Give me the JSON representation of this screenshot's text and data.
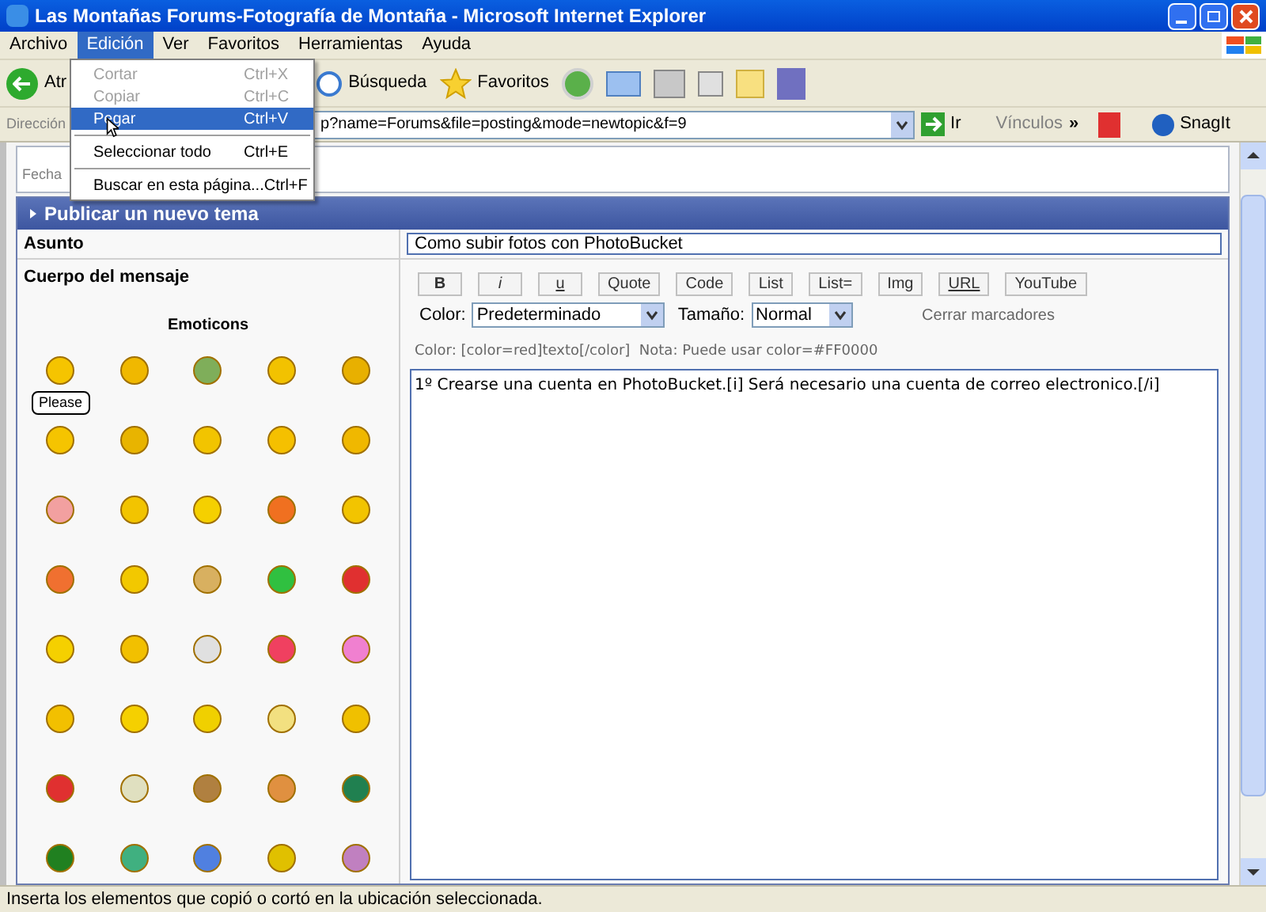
{
  "window": {
    "title": "Las Montañas Forums-Fotografía de Montaña - Microsoft Internet Explorer"
  },
  "menu_bar": [
    {
      "label": "Archivo",
      "selected": false
    },
    {
      "label": "Edición",
      "selected": true
    },
    {
      "label": "Ver",
      "selected": false
    },
    {
      "label": "Favoritos",
      "selected": false
    },
    {
      "label": "Herramientas",
      "selected": false
    },
    {
      "label": "Ayuda",
      "selected": false
    }
  ],
  "edit_menu": [
    {
      "kind": "item",
      "label": "Cortar",
      "shortcut": "Ctrl+X",
      "disabled": true,
      "selected": false
    },
    {
      "kind": "item",
      "label": "Copiar",
      "shortcut": "Ctrl+C",
      "disabled": true,
      "selected": false
    },
    {
      "kind": "item",
      "label": "Pegar",
      "shortcut": "Ctrl+V",
      "disabled": false,
      "selected": true
    },
    {
      "kind": "separator"
    },
    {
      "kind": "item",
      "label": "Seleccionar todo",
      "shortcut": "Ctrl+E",
      "disabled": false,
      "selected": false
    },
    {
      "kind": "separator"
    },
    {
      "kind": "item",
      "label": "Buscar en esta página...",
      "shortcut": "Ctrl+F",
      "disabled": false,
      "selected": false
    }
  ],
  "toolbar": {
    "back_label": "Atr",
    "search_label": "Búsqueda",
    "favorites_label": "Favoritos"
  },
  "address_bar": {
    "label": "Dirección",
    "url": "p?name=Forums&file=posting&mode=newtopic&f=9",
    "go_label": "Ir",
    "links_label": "Vínculos",
    "chevron": "»",
    "snagit_label": "SnagIt"
  },
  "page": {
    "date_label": "Fecha",
    "form_title": "Publicar un nuevo tema",
    "subject_label": "Asunto",
    "subject_value": "Como subir fotos con PhotoBucket",
    "body_label": "Cuerpo del mensaje",
    "emoticons_title": "Emoticons",
    "emoticon_bubble": "Please",
    "bbcode_buttons": [
      "B",
      "i",
      "u",
      "Quote",
      "Code",
      "List",
      "List=",
      "Img",
      "URL",
      "YouTube"
    ],
    "color_label": "Color:",
    "color_value": "Predeterminado",
    "size_label": "Tamaño:",
    "size_value": "Normal",
    "close_tags": "Cerrar marcadores",
    "help_line": "Color: [color=red]texto[/color]  Nota: Puede usar color=#FF0000",
    "message": "1º Crearse una cuenta en PhotoBucket.[i] Será necesario una cuenta de correo electronico.[/i]"
  },
  "status_bar": {
    "text": "Inserta los elementos que copió o cortó en la ubicación seleccionada."
  }
}
